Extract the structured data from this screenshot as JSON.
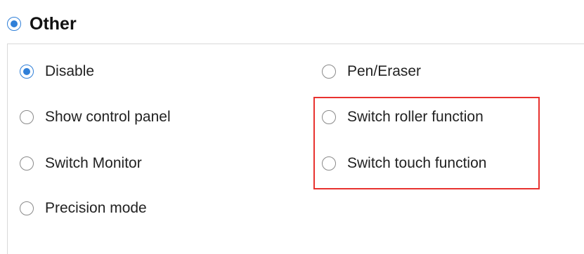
{
  "section": {
    "title": "Other",
    "selected": true
  },
  "options": {
    "left": [
      {
        "label": "Disable",
        "checked": true
      },
      {
        "label": "Show control panel",
        "checked": false
      },
      {
        "label": "Switch Monitor",
        "checked": false
      },
      {
        "label": "Precision mode",
        "checked": false
      }
    ],
    "right": [
      {
        "label": "Pen/Eraser",
        "checked": false
      },
      {
        "label": "Switch roller function",
        "checked": false
      },
      {
        "label": "Switch touch function",
        "checked": false
      }
    ]
  },
  "colors": {
    "accent": "#2f7fd8",
    "highlight": "#e8322f",
    "text": "#222222",
    "border": "#d9d9d9"
  }
}
